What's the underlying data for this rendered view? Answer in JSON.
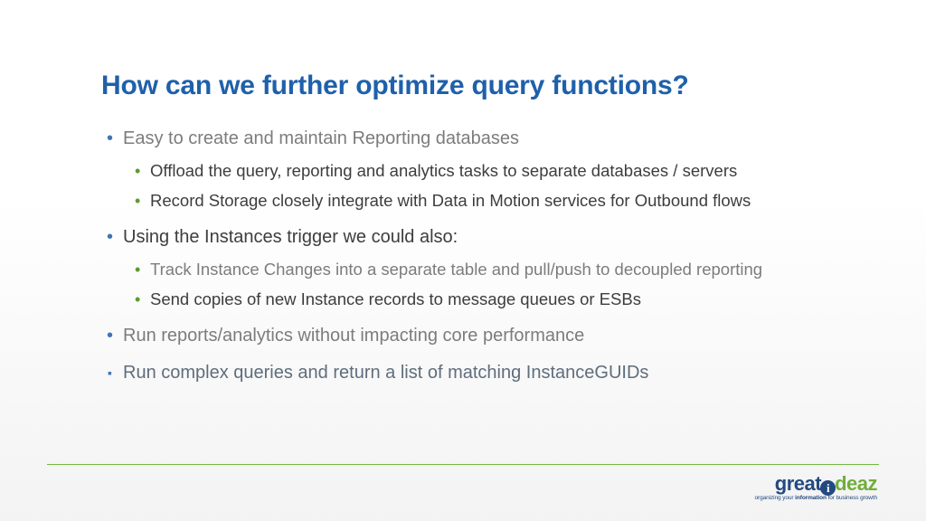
{
  "title": "How can we further optimize query functions?",
  "bullets": {
    "b1": "Easy to create and maintain Reporting databases",
    "b1_1": "Offload the query, reporting and analytics tasks to separate databases / servers",
    "b1_2": "Record Storage closely integrate with Data in Motion services for Outbound flows",
    "b2": "Using the Instances trigger we could also:",
    "b2_1": "Track Instance Changes into a separate table and pull/push to decoupled reporting",
    "b2_2": "Send copies of new Instance records to message queues or ESBs",
    "b3": "Run reports/analytics without impacting core performance",
    "b4": "Run complex queries and return a list of matching InstanceGUIDs"
  },
  "logo": {
    "part1": "great",
    "part2": "i",
    "part3": "deaz",
    "tagline_pre": "organizing your ",
    "tagline_bold": "information",
    "tagline_post": " for business growth"
  }
}
